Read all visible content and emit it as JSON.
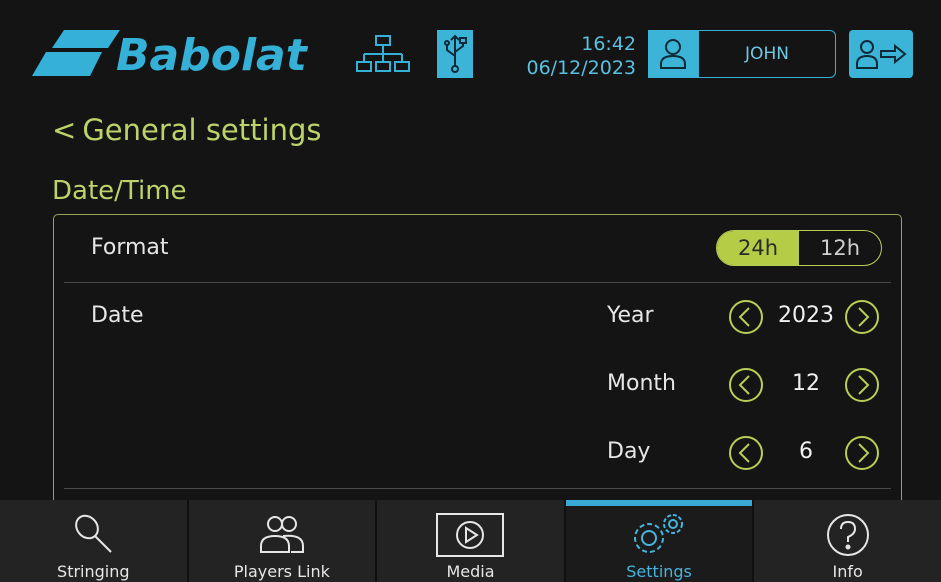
{
  "header": {
    "brand": "Babolat",
    "time": "16:42",
    "date": "06/12/2023",
    "user_name": "JOHN"
  },
  "nav": {
    "back_label": "General settings"
  },
  "section": {
    "title": "Date/Time"
  },
  "format": {
    "label": "Format",
    "options": [
      "24h",
      "12h"
    ],
    "selected": "24h"
  },
  "date": {
    "label": "Date",
    "fields": [
      {
        "label": "Year",
        "value": "2023"
      },
      {
        "label": "Month",
        "value": "12"
      },
      {
        "label": "Day",
        "value": "6"
      }
    ]
  },
  "bottom_nav": {
    "tabs": [
      {
        "label": "Stringing",
        "icon": "racket-icon"
      },
      {
        "label": "Players Link",
        "icon": "players-icon"
      },
      {
        "label": "Media",
        "icon": "play-icon"
      },
      {
        "label": "Settings",
        "icon": "gears-icon",
        "active": true
      },
      {
        "label": "Info",
        "icon": "question-icon"
      }
    ]
  },
  "colors": {
    "background": "#141414",
    "accent_blue": "#3cb4d8",
    "accent_green": "#b5cd46",
    "text_green": "#bcd36a"
  }
}
